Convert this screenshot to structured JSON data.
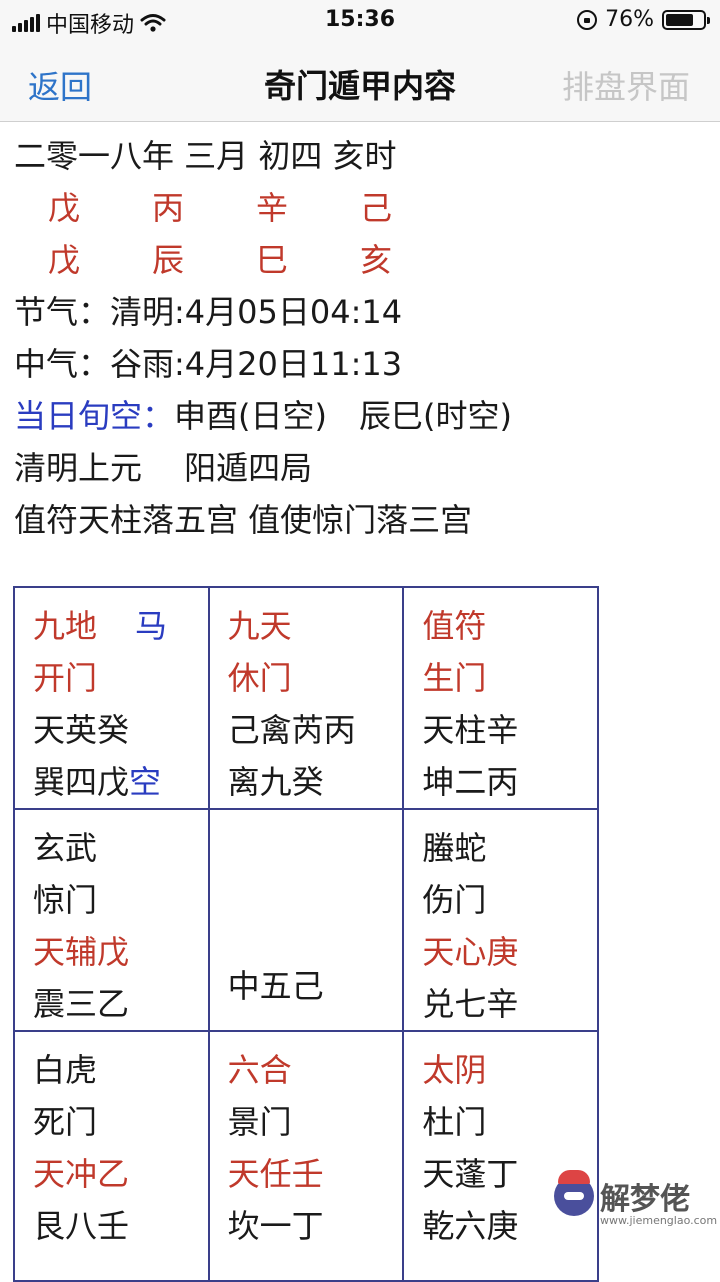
{
  "status_bar": {
    "carrier": "中国移动",
    "time": "15:36",
    "battery_text": "76%",
    "battery_level": 0.76
  },
  "nav": {
    "back": "返回",
    "title": "奇门遁甲内容",
    "right": "排盘界面"
  },
  "info": {
    "date": "二零一八年 三月 初四 亥时",
    "stems": [
      "戊",
      "丙",
      "辛",
      "己"
    ],
    "branches": [
      "戊",
      "辰",
      "巳",
      "亥"
    ],
    "jieqi_label": "节气：",
    "jieqi_value": "清明:4月05日04:14",
    "zhongqi_label": "中气：",
    "zhongqi_value": "谷雨:4月20日11:13",
    "xunkong_label": "当日旬空：",
    "xunkong_value": "申酉(日空)　辰巳(时空)",
    "yuan": "清明上元　 阳遁四局",
    "zhifu": "值符天柱落五宫 值使惊门落三宫"
  },
  "grid": {
    "r1c1": {
      "l1a": "九地",
      "l1b": "马",
      "l2": "开门",
      "l3": "天英癸",
      "l4a": "巽四戊",
      "l4b": "空"
    },
    "r1c2": {
      "l1": "九天",
      "l2": "休门",
      "l3": "己禽芮丙",
      "l4": "离九癸"
    },
    "r1c3": {
      "l1": "值符",
      "l2": "生门",
      "l3": "天柱辛",
      "l4": "坤二丙"
    },
    "r2c1": {
      "l1": "玄武",
      "l2": "惊门",
      "l3": "天辅戊",
      "l4": "震三乙"
    },
    "r2c2": {
      "center": "中五己"
    },
    "r2c3": {
      "l1": "螣蛇",
      "l2": "伤门",
      "l3": "天心庚",
      "l4": "兑七辛"
    },
    "r3c1": {
      "l1": "白虎",
      "l2": "死门",
      "l3": "天冲乙",
      "l4": "艮八壬"
    },
    "r3c2": {
      "l1": "六合",
      "l2": "景门",
      "l3": "天任壬",
      "l4": "坎一丁"
    },
    "r3c3": {
      "l1": "太阴",
      "l2": "杜门",
      "l3": "天蓬丁",
      "l4": "乾六庚"
    }
  },
  "watermark": {
    "text": "解梦佬",
    "url": "www.jiemenglao.com"
  }
}
